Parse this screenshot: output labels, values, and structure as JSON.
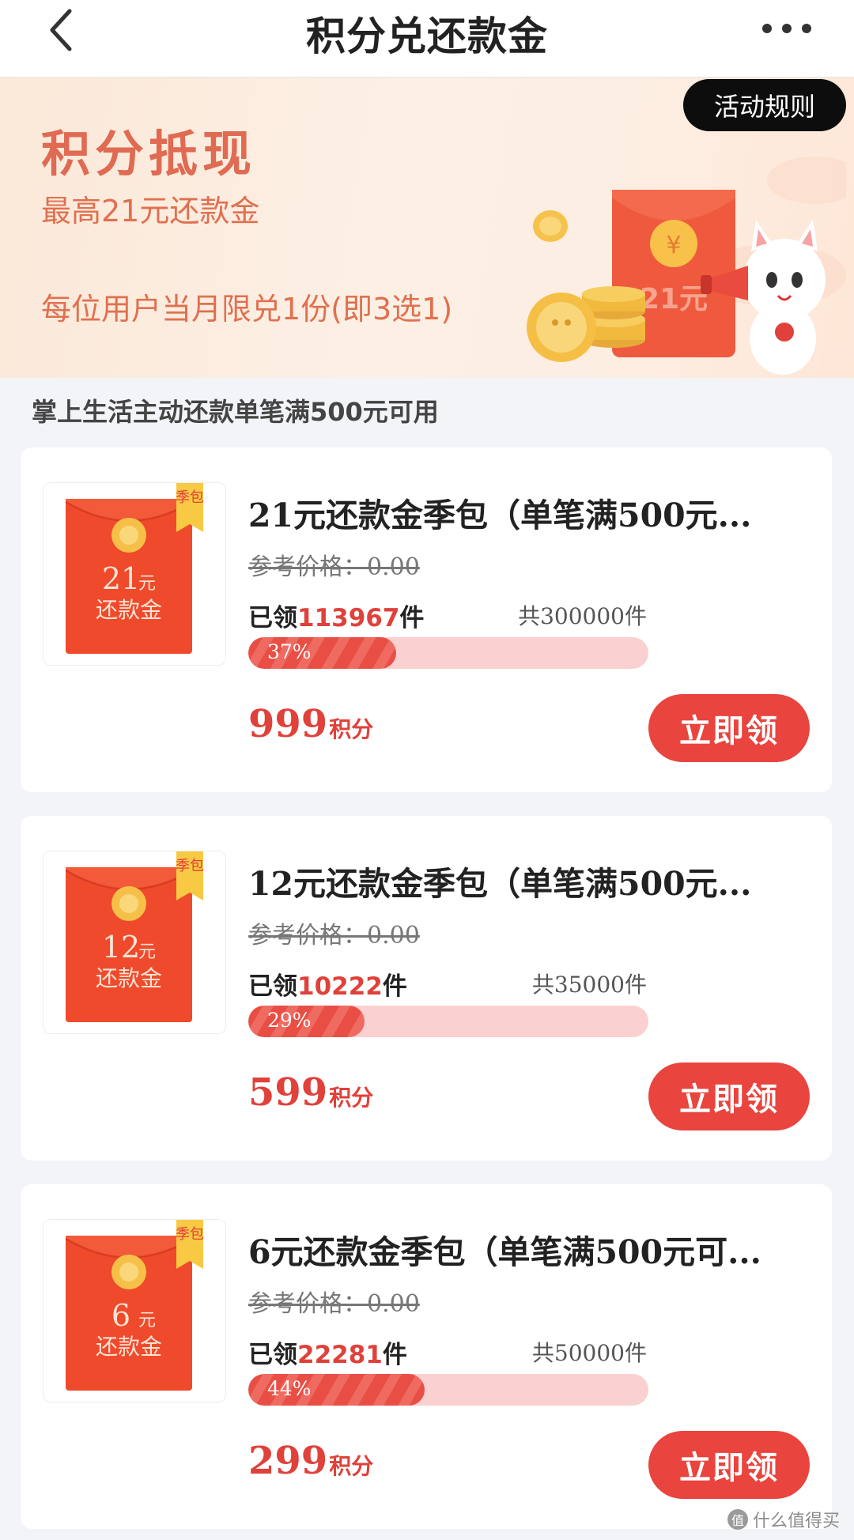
{
  "header": {
    "title": "积分兑还款金"
  },
  "banner": {
    "rules_label": "活动规则",
    "title": "积分抵现",
    "subtitle": "最高21元还款金",
    "limit": "每位用户当月限兑1份(即3选1)",
    "envelope_text": "21元"
  },
  "section_tip": "掌上生活主动还款单笔满500元可用",
  "items": [
    {
      "badge": "季包",
      "amount": "21",
      "unit": "元",
      "label": "还款金",
      "name": "21元还款金季包（单笔满500元...",
      "ref_price": "参考价格：0.00",
      "claimed_prefix": "已领",
      "claimed_count": "113967",
      "claimed_suffix": "件",
      "total": "共300000件",
      "progress_label": "37%",
      "progress": 0.37,
      "points": "999",
      "points_unit": "积分",
      "button": "立即领"
    },
    {
      "badge": "季包",
      "amount": "12",
      "unit": "元",
      "label": "还款金",
      "name": "12元还款金季包（单笔满500元...",
      "ref_price": "参考价格：0.00",
      "claimed_prefix": "已领",
      "claimed_count": "10222",
      "claimed_suffix": "件",
      "total": "共35000件",
      "progress_label": "29%",
      "progress": 0.29,
      "points": "599",
      "points_unit": "积分",
      "button": "立即领"
    },
    {
      "badge": "季包",
      "amount": "6",
      "unit": "元",
      "label": "还款金",
      "name": "6元还款金季包（单笔满500元可...",
      "ref_price": "参考价格：0.00",
      "claimed_prefix": "已领",
      "claimed_count": "22281",
      "claimed_suffix": "件",
      "total": "共50000件",
      "progress_label": "44%",
      "progress": 0.44,
      "points": "299",
      "points_unit": "积分",
      "button": "立即领"
    }
  ],
  "watermark": {
    "icon_text": "值",
    "text": "什么值得买"
  },
  "colors": {
    "accent": "#e9443e",
    "banner_text": "#e0704f",
    "progress_track": "#fbd0d0"
  },
  "icons": {
    "back": "chevron-left-icon",
    "more": "more-dots-icon"
  }
}
